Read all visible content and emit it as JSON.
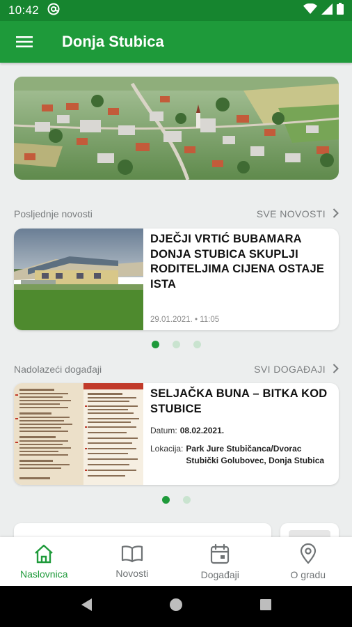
{
  "status_bar": {
    "time": "10:42",
    "left_icons": [
      "at-sign-icon"
    ],
    "right_icons": [
      "wifi-icon",
      "signal-icon",
      "battery-icon"
    ]
  },
  "app_bar": {
    "title": "Donja Stubica",
    "menu_icon": "hamburger-menu-icon"
  },
  "colors": {
    "primary": "#1e9a3a",
    "status_bar": "#16852f",
    "background": "#eceeee",
    "muted_text": "#7a7d7f"
  },
  "news_section": {
    "label": "Posljednje novosti",
    "more_label": "SVE NOVOSTI",
    "card": {
      "title": "DJEČJI VRTIĆ BUBAMARA DONJA STUBICA SKUPLJI RODITELJIMA CIJENA OSTAJE ISTA",
      "date": "29.01.2021.",
      "separator": "•",
      "time": "11:05"
    },
    "pager": {
      "count": 3,
      "active": 0
    }
  },
  "events_section": {
    "label": "Nadolazeći događaji",
    "more_label": "SVI DOGAĐAJI",
    "card": {
      "title": "SELJAČKA BUNA – BITKA KOD STUBICE",
      "date_label": "Datum:",
      "date_value": "08.02.2021.",
      "location_label": "Lokacija:",
      "location_value": "Park Jure Stubičanca/Dvorac Stubički Golubovec, Donja Stubica"
    },
    "pager": {
      "count": 2,
      "active": 0
    }
  },
  "bottom_nav": {
    "items": [
      {
        "label": "Naslovnica",
        "icon": "home-icon",
        "active": true
      },
      {
        "label": "Novosti",
        "icon": "book-icon",
        "active": false
      },
      {
        "label": "Događaji",
        "icon": "calendar-icon",
        "active": false
      },
      {
        "label": "O gradu",
        "icon": "location-pin-icon",
        "active": false
      }
    ]
  },
  "system_nav": [
    "back-icon",
    "home-circle-icon",
    "recents-icon"
  ]
}
